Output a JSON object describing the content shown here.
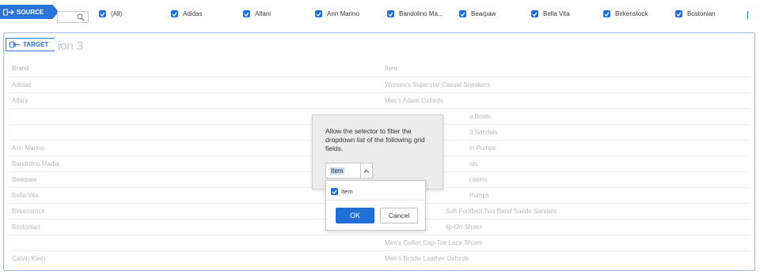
{
  "source": {
    "label": "SOURCE",
    "search_icon": "search-icon"
  },
  "filters": [
    {
      "label": "(All)",
      "checked": true
    },
    {
      "label": "Adidas",
      "checked": true
    },
    {
      "label": "Alfani",
      "checked": true
    },
    {
      "label": "Ann Marino",
      "checked": true
    },
    {
      "label": "Bandolino Ma...",
      "checked": true
    },
    {
      "label": "Bearpaw",
      "checked": true
    },
    {
      "label": "Bella Vita",
      "checked": true
    },
    {
      "label": "Birkenstock",
      "checked": true
    },
    {
      "label": "Bostonian",
      "checked": true
    }
  ],
  "target": {
    "label": "TARGET",
    "section_title": "ion 3"
  },
  "grid": {
    "columns": [
      "Brand",
      "Item"
    ],
    "rows": [
      {
        "brand": "Adidas",
        "item": "Women's Superstar Casual Sneakers"
      },
      {
        "brand": "Alfani",
        "item": "Men's Adam Oxfords"
      },
      {
        "brand": "",
        "item": "a Boots"
      },
      {
        "brand": "",
        "item": "d Sandals"
      },
      {
        "brand": "Ann Marino",
        "item": "le Pumps"
      },
      {
        "brand": "Bandolino Madia",
        "item": "als"
      },
      {
        "brand": "Bearpaw",
        "item": "casins"
      },
      {
        "brand": "Bella Vita",
        "item": "Pumps"
      },
      {
        "brand": "Birkenstock",
        "item": "Soft Footbed Two Band Suede Sandals"
      },
      {
        "brand": "Bostonian",
        "item": "lip-On Shoes"
      },
      {
        "brand": "",
        "item": "Men's Collier Cap-Toe Lace Shoes"
      },
      {
        "brand": "Calvin Klein",
        "item": "Men's Brodie Leather Oxfords"
      }
    ]
  },
  "popover": {
    "description": "Allow the selector to filter the dropdown list of the following grid fields.",
    "select_value": "Item",
    "options": [
      {
        "label": "Item",
        "checked": true
      }
    ],
    "ok_label": "OK",
    "cancel_label": "Cancel"
  },
  "colors": {
    "accent": "#1f6fd6",
    "panel_border": "#9fb9de",
    "popover_bg": "#ececec"
  }
}
